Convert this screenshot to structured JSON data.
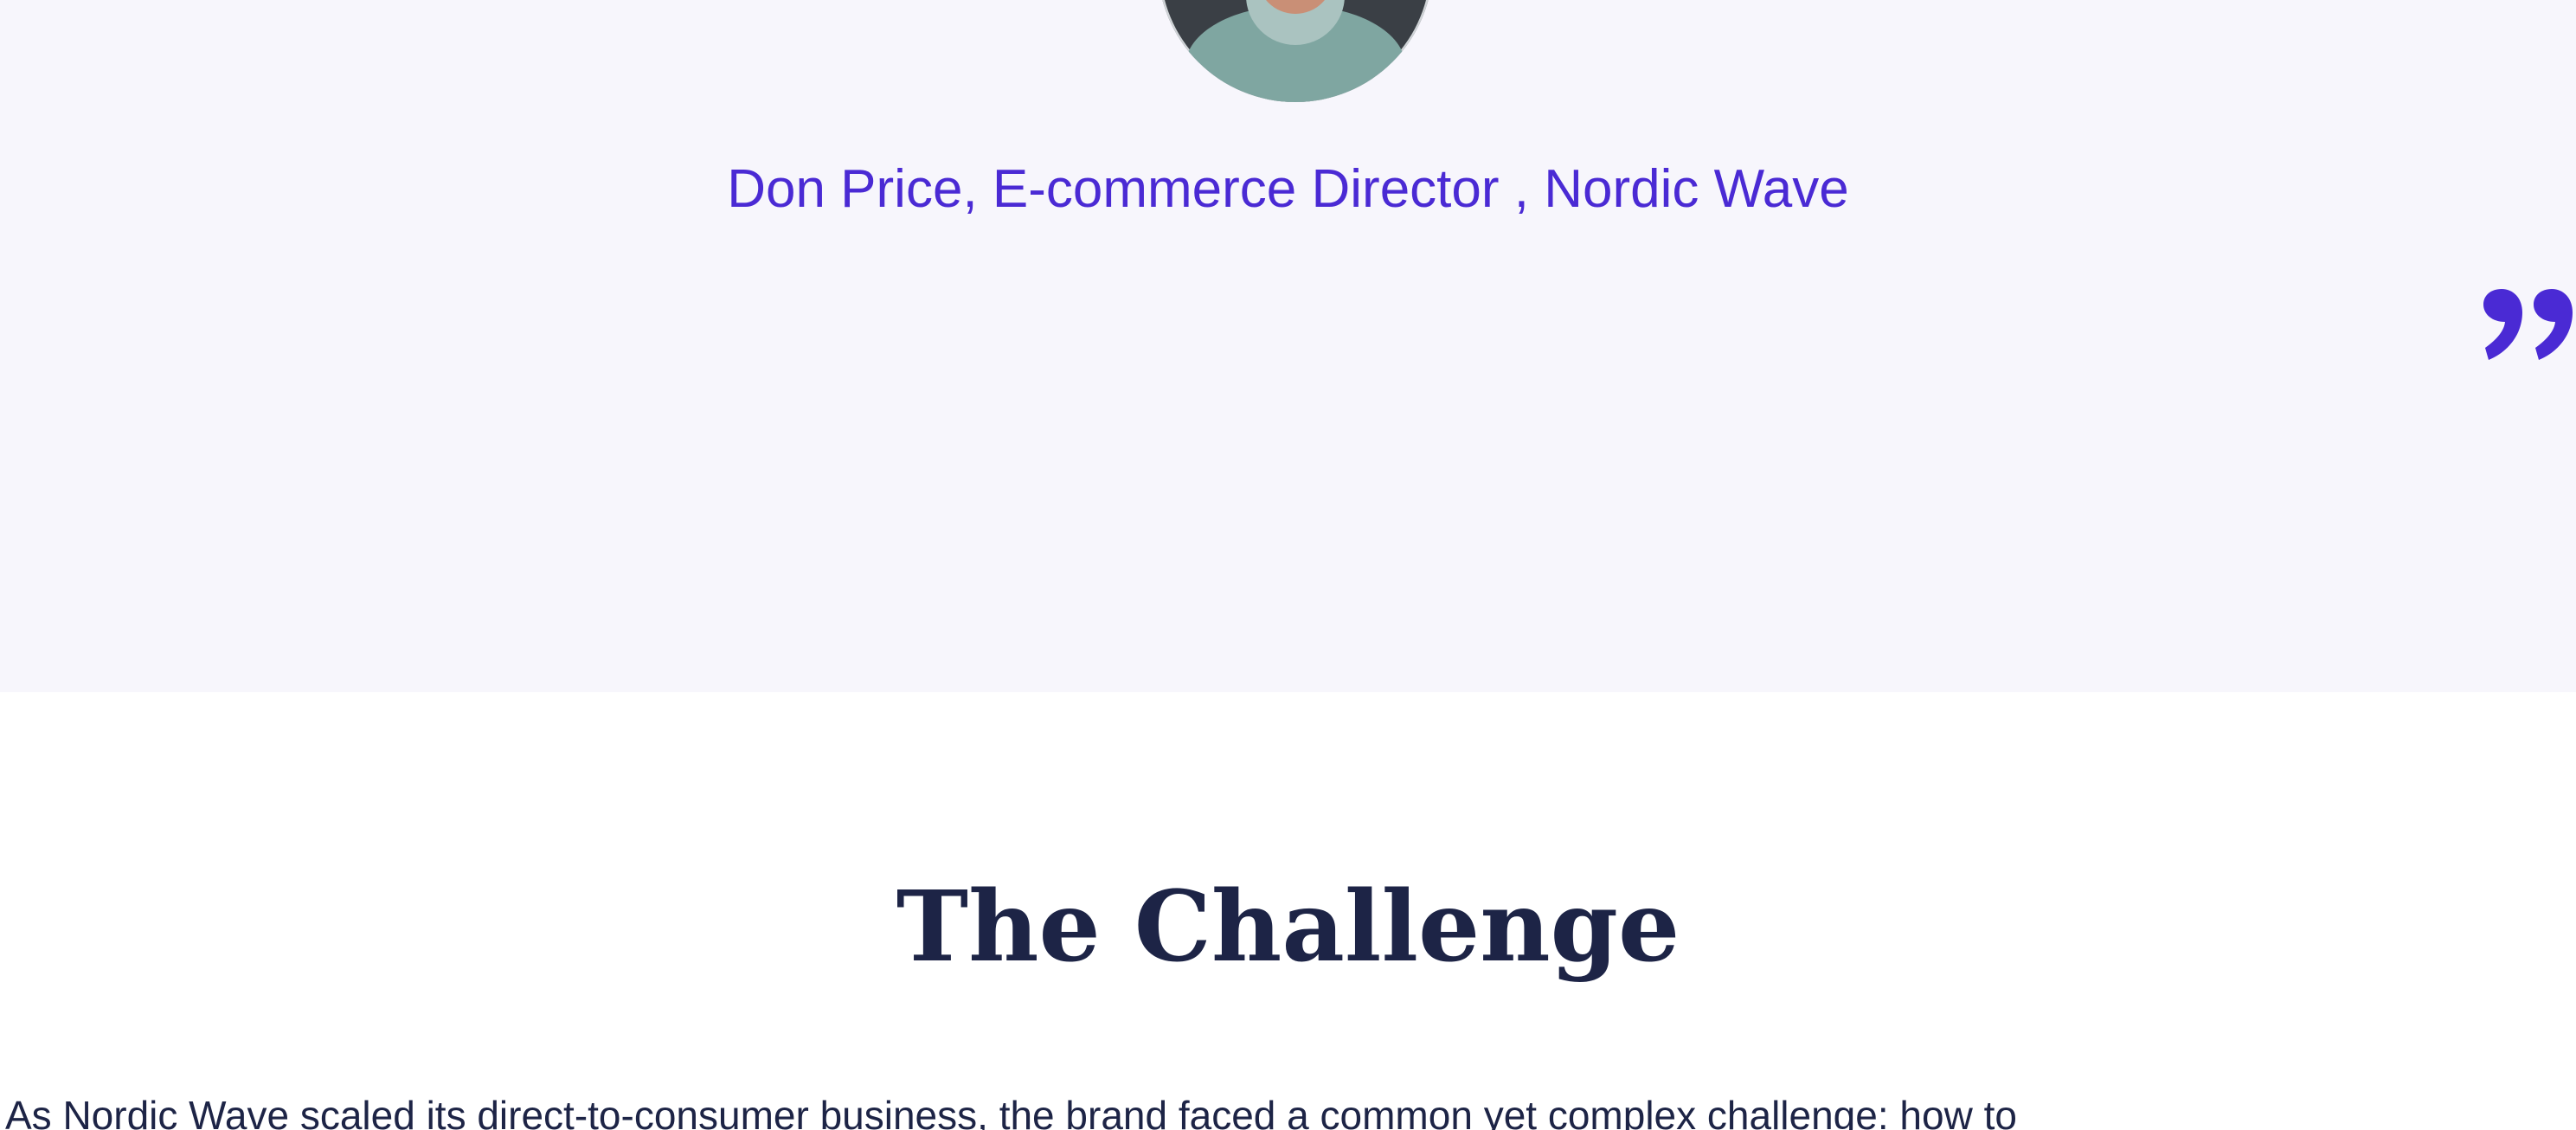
{
  "testimonial": {
    "author": "Don Price, E-commerce Director , Nordic Wave",
    "avatar_alt": "portrait of Don Price",
    "quote_icon": "closing-quote-icon"
  },
  "challenge": {
    "title": "The Challenge",
    "body": "As Nordic Wave scaled its direct-to-consumer business, the brand faced a common yet complex challenge: how to"
  },
  "colors": {
    "accent": "#4a2ad4",
    "heading": "#1d2446",
    "section_bg": "#f7f6fc"
  }
}
